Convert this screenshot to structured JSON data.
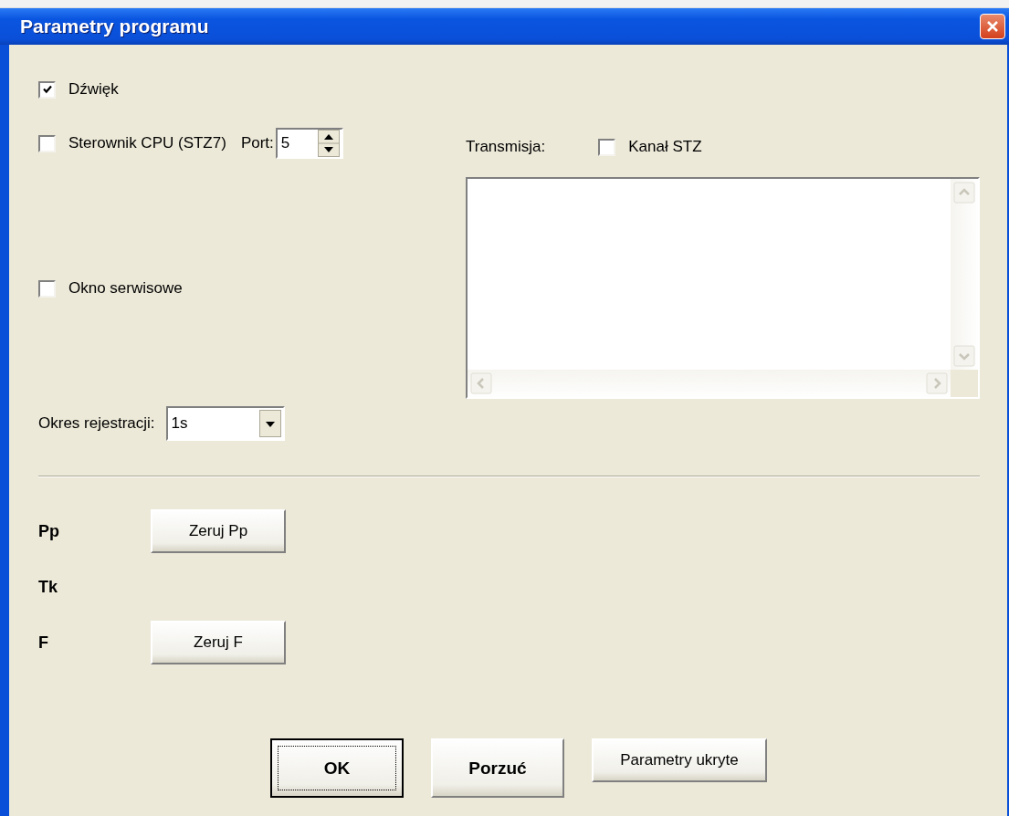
{
  "window": {
    "title": "Parametry programu"
  },
  "sound": {
    "label": "Dźwięk",
    "checked": true
  },
  "cpu": {
    "label": "Sterownik CPU (STZ7)",
    "checked": false,
    "port_label": "Port:",
    "port_value": "5"
  },
  "service_window": {
    "label": "Okno serwisowe",
    "checked": false
  },
  "period": {
    "label": "Okres rejestracji:",
    "value": "1s"
  },
  "transmission": {
    "label": "Transmisja:",
    "channel": {
      "label": "Kanał STZ",
      "checked": false
    }
  },
  "counters": [
    {
      "label": "Pp",
      "button": "Zeruj Pp"
    },
    {
      "label": "Tk"
    },
    {
      "label": "F",
      "button": "Zeruj F"
    }
  ],
  "buttons": [
    {
      "label": "OK",
      "kind": "default"
    },
    {
      "label": "Porzuć",
      "kind": "bold"
    },
    {
      "label": "Parametry ukryte",
      "kind": "plain"
    }
  ]
}
